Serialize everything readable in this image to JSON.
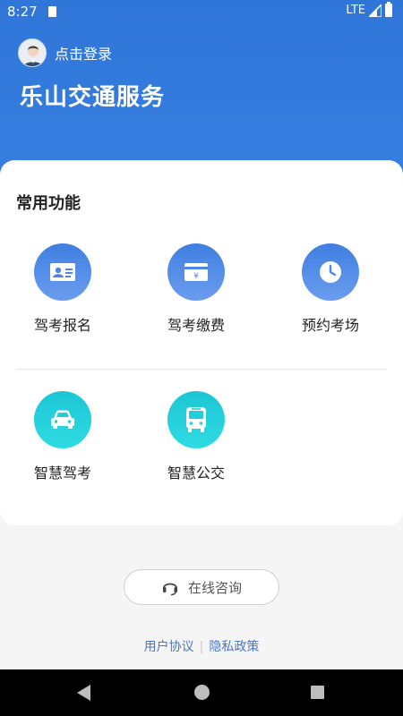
{
  "status_bar": {
    "time": "8:27",
    "network": "LTE"
  },
  "header": {
    "login_text": "点击登录",
    "app_title": "乐山交通服务"
  },
  "functions": {
    "section_title": "常用功能",
    "items": [
      {
        "label": "驾考报名",
        "icon": "id-card-icon"
      },
      {
        "label": "驾考缴费",
        "icon": "payment-card-icon"
      },
      {
        "label": "预约考场",
        "icon": "clock-icon"
      },
      {
        "label": "智慧驾考",
        "icon": "car-icon"
      },
      {
        "label": "智慧公交",
        "icon": "bus-icon"
      }
    ]
  },
  "consult": {
    "label": "在线咨询",
    "icon": "headset-icon"
  },
  "footer": {
    "user_agreement": "用户协议",
    "privacy_policy": "隐私政策",
    "separator": "|"
  },
  "colors": {
    "header_blue": "#2f76d8",
    "icon_blue": "#4f86e6",
    "icon_teal": "#22cfd9",
    "link": "#4a78c6"
  }
}
